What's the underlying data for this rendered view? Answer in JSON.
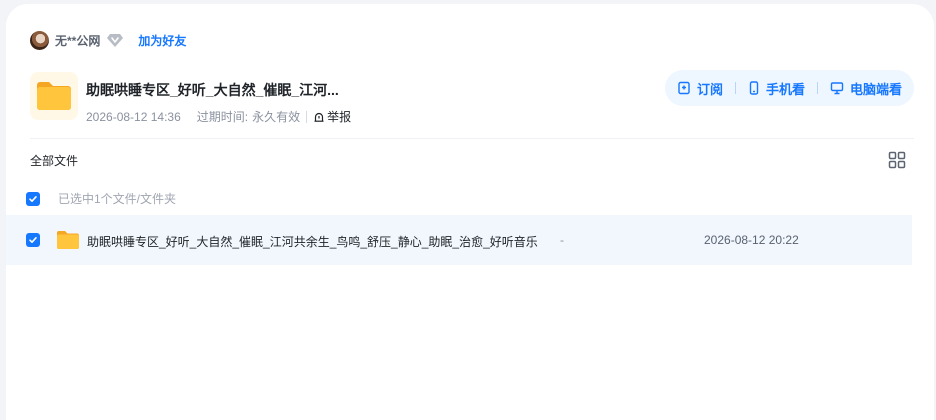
{
  "user": {
    "name": "无**公网",
    "add_friend": "加为好友"
  },
  "share": {
    "title": "助眠哄睡专区_好听_大自然_催眠_江河...",
    "created": "2026-08-12 14:36",
    "expire_label": "过期时间:",
    "expire_value": "永久有效",
    "report": "举报"
  },
  "actions": {
    "subscribe": "订阅",
    "mobile": "手机看",
    "desktop": "电脑端看"
  },
  "list": {
    "header": "全部文件",
    "selected_text": "已选中1个文件/文件夹",
    "files": [
      {
        "name": "助眠哄睡专区_好听_大自然_催眠_江河共余生_鸟鸣_舒压_静心_助眠_治愈_好听音乐",
        "size": "-",
        "date": "2026-08-12 20:22",
        "checked": true
      }
    ]
  },
  "colors": {
    "accent": "#1677ff",
    "folder": "#ffc53d",
    "row_highlight": "#f1f7fd",
    "action_bg": "#eef6ff"
  }
}
